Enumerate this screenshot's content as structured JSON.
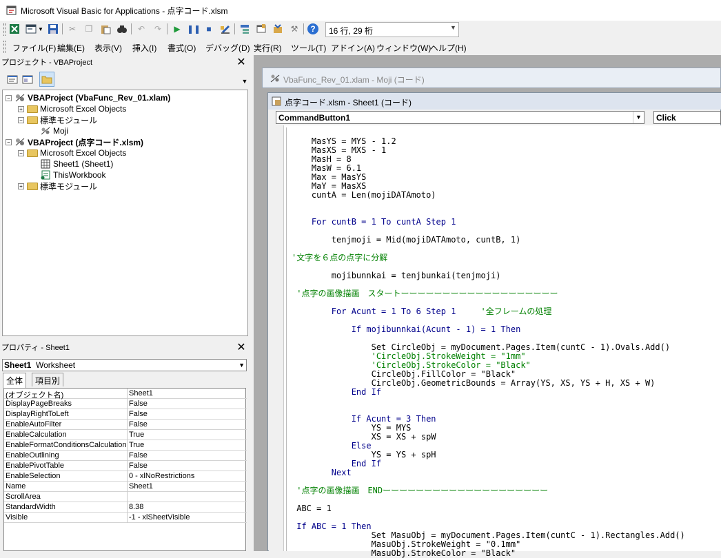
{
  "window": {
    "title": "Microsoft Visual Basic for Applications - 点字コード.xlsm"
  },
  "toolbar": {
    "position_indicator": "16 行, 29 桁"
  },
  "menu": [
    "ファイル(F)",
    "編集(E)",
    "表示(V)",
    "挿入(I)",
    "書式(O)",
    "デバッグ(D)",
    "実行(R)",
    "ツール(T)",
    "アドイン(A)",
    "ウィンドウ(W)",
    "ヘルプ(H)"
  ],
  "project_panel": {
    "title": "プロジェクト - VBAProject",
    "tree": [
      {
        "label": "VBAProject (VbaFunc_Rev_01.xlam)",
        "level": 0,
        "expander": "−",
        "bold": true,
        "icon": "project-icon"
      },
      {
        "label": "Microsoft Excel Objects",
        "level": 1,
        "expander": "+",
        "bold": false,
        "icon": "folder-icon"
      },
      {
        "label": "標準モジュール",
        "level": 1,
        "expander": "−",
        "bold": false,
        "icon": "folder-icon"
      },
      {
        "label": "Moji",
        "level": 2,
        "expander": "",
        "bold": false,
        "icon": "module-icon"
      },
      {
        "label": "VBAProject (点字コード.xlsm)",
        "level": 0,
        "expander": "−",
        "bold": true,
        "icon": "project-icon"
      },
      {
        "label": "Microsoft Excel Objects",
        "level": 1,
        "expander": "−",
        "bold": false,
        "icon": "folder-icon"
      },
      {
        "label": "Sheet1 (Sheet1)",
        "level": 2,
        "expander": "",
        "bold": false,
        "icon": "sheet-icon"
      },
      {
        "label": "ThisWorkbook",
        "level": 2,
        "expander": "",
        "bold": false,
        "icon": "workbook-icon"
      },
      {
        "label": "標準モジュール",
        "level": 1,
        "expander": "+",
        "bold": false,
        "icon": "folder-icon"
      }
    ]
  },
  "properties_panel": {
    "title": "プロパティ - Sheet1",
    "object_name": "Sheet1",
    "object_type": "Worksheet",
    "tabs": [
      "全体",
      "項目別"
    ],
    "rows": [
      {
        "key": "(オブジェクト名)",
        "value": "Sheet1"
      },
      {
        "key": "DisplayPageBreaks",
        "value": "False"
      },
      {
        "key": "DisplayRightToLeft",
        "value": "False"
      },
      {
        "key": "EnableAutoFilter",
        "value": "False"
      },
      {
        "key": "EnableCalculation",
        "value": "True"
      },
      {
        "key": "EnableFormatConditionsCalculation",
        "value": "True"
      },
      {
        "key": "EnableOutlining",
        "value": "False"
      },
      {
        "key": "EnablePivotTable",
        "value": "False"
      },
      {
        "key": "EnableSelection",
        "value": "0 - xlNoRestrictions"
      },
      {
        "key": "Name",
        "value": "Sheet1"
      },
      {
        "key": "ScrollArea",
        "value": ""
      },
      {
        "key": "StandardWidth",
        "value": "8.38"
      },
      {
        "key": "Visible",
        "value": "-1 - xlSheetVisible"
      }
    ]
  },
  "code_windows": {
    "back_title": "VbaFunc_Rev_01.xlam - Moji (コード)",
    "front_title": "点字コード.xlsm - Sheet1 (コード)",
    "object_combo": "CommandButton1",
    "proc_combo": "Click"
  },
  "code_lines": [
    {
      "text": "    MasYS = MYS - 1.2",
      "kind": "code"
    },
    {
      "text": "    MasXS = MXS - 1",
      "kind": "code"
    },
    {
      "text": "    MasH = 8",
      "kind": "code"
    },
    {
      "text": "    MasW = 6.1",
      "kind": "code"
    },
    {
      "text": "    Max = MasYS",
      "kind": "code"
    },
    {
      "text": "    MaY = MasXS",
      "kind": "code"
    },
    {
      "text": "    cuntA = Len(mojiDATAmoto)",
      "kind": "code"
    },
    {
      "text": "",
      "kind": "code"
    },
    {
      "text": "",
      "kind": "code"
    },
    {
      "text": "    For cuntB = 1 To cuntA Step 1",
      "kind": "kw"
    },
    {
      "text": "",
      "kind": "code"
    },
    {
      "text": "        tenjmoji = Mid(mojiDATAmoto, cuntB, 1)",
      "kind": "code"
    },
    {
      "text": "",
      "kind": "code"
    },
    {
      "text": "'文字を６点の点字に分解",
      "kind": "cm"
    },
    {
      "text": "",
      "kind": "code"
    },
    {
      "text": "        mojibunnkai = tenjbunkai(tenjmoji)",
      "kind": "code"
    },
    {
      "text": "",
      "kind": "code"
    },
    {
      "text": " '点字の画像描画　スタートーーーーーーーーーーーーーーーーーーー",
      "kind": "cm"
    },
    {
      "text": "",
      "kind": "code"
    },
    {
      "text": "        For Acunt = 1 To 6 Step 1     '全フレームの処理",
      "kind": "mix1"
    },
    {
      "text": "",
      "kind": "code"
    },
    {
      "text": "            If mojibunnkai(Acunt - 1) = 1 Then",
      "kind": "kw"
    },
    {
      "text": "",
      "kind": "code"
    },
    {
      "text": "                Set CircleObj = myDocument.Pages.Item(cuntC - 1).Ovals.Add()",
      "kind": "code"
    },
    {
      "text": "                'CircleObj.StrokeWeight = \"1mm\"",
      "kind": "cm"
    },
    {
      "text": "                'CircleObj.StrokeColor = \"Black\"",
      "kind": "cm"
    },
    {
      "text": "                CircleObj.FillColor = \"Black\"",
      "kind": "code"
    },
    {
      "text": "                CircleObj.GeometricBounds = Array(YS, XS, YS + H, XS + W)",
      "kind": "code"
    },
    {
      "text": "            End If",
      "kind": "kw"
    },
    {
      "text": "",
      "kind": "code"
    },
    {
      "text": "",
      "kind": "code"
    },
    {
      "text": "            If Acunt = 3 Then",
      "kind": "kw"
    },
    {
      "text": "                YS = MYS",
      "kind": "code"
    },
    {
      "text": "                XS = XS + spW",
      "kind": "code"
    },
    {
      "text": "            Else",
      "kind": "kw"
    },
    {
      "text": "                YS = YS + spH",
      "kind": "code"
    },
    {
      "text": "            End If",
      "kind": "kw"
    },
    {
      "text": "        Next",
      "kind": "kw"
    },
    {
      "text": "",
      "kind": "code"
    },
    {
      "text": " '点字の画像描画　ENDーーーーーーーーーーーーーーーーーーーー",
      "kind": "cm"
    },
    {
      "text": "",
      "kind": "code"
    },
    {
      "text": " ABC = 1",
      "kind": "code"
    },
    {
      "text": "",
      "kind": "code"
    },
    {
      "text": " If ABC = 1 Then",
      "kind": "kw"
    },
    {
      "text": "                Set MasuObj = myDocument.Pages.Item(cuntC - 1).Rectangles.Add()",
      "kind": "code"
    },
    {
      "text": "                MasuObj.StrokeWeight = \"0.1mm\"",
      "kind": "code"
    },
    {
      "text": "                MasuObj.StrokeColor = \"Black\"",
      "kind": "code"
    }
  ]
}
